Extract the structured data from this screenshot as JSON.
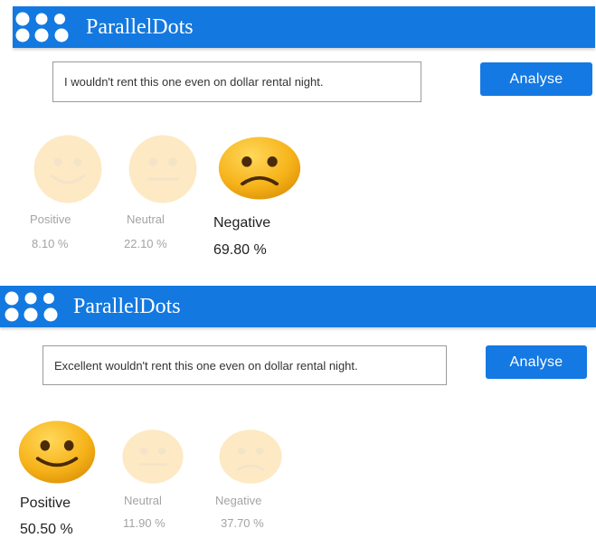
{
  "colors": {
    "header": "#1379e0",
    "button": "#1479e3",
    "emoji_active": "#f6b31a",
    "emoji_faded": "#fde9c4",
    "label_dim": "#a4a4a4"
  },
  "panels": [
    {
      "brand": "ParallelDots",
      "input_text": "I wouldn't rent this one even on dollar rental night.",
      "button_label": "Analyse",
      "results": [
        {
          "label": "Positive",
          "value": "8.10 %",
          "active": false,
          "icon": "smile-icon"
        },
        {
          "label": "Neutral",
          "value": "22.10 %",
          "active": false,
          "icon": "neutral-face-icon"
        },
        {
          "label": "Negative",
          "value": "69.80 %",
          "active": true,
          "icon": "frown-icon"
        }
      ]
    },
    {
      "brand": "ParallelDots",
      "input_text": "Excellent wouldn't rent this one even on dollar rental night.",
      "button_label": "Analyse",
      "results": [
        {
          "label": "Positive",
          "value": "50.50 %",
          "active": true,
          "icon": "smile-icon"
        },
        {
          "label": "Neutral",
          "value": "11.90 %",
          "active": false,
          "icon": "neutral-face-icon"
        },
        {
          "label": "Negative",
          "value": "37.70 %",
          "active": false,
          "icon": "frown-icon"
        }
      ]
    }
  ]
}
